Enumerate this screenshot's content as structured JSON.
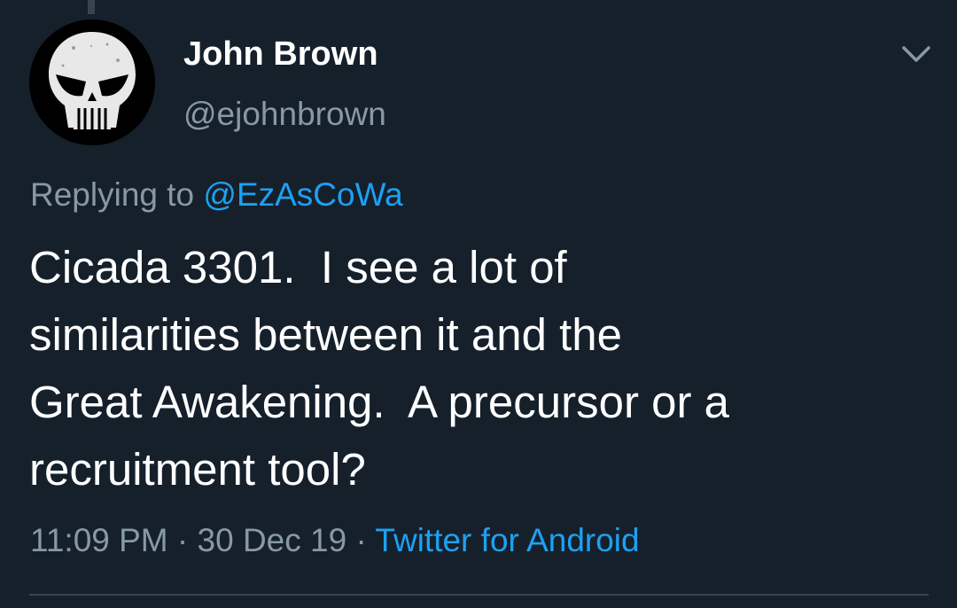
{
  "colors": {
    "background": "#15202b",
    "primary_text": "#ffffff",
    "secondary_text": "#8899a6",
    "accent": "#1da1f2",
    "divider": "#38444d"
  },
  "tweet": {
    "author": {
      "display_name": "John Brown",
      "handle": "@ejohnbrown",
      "avatar_icon": "punisher-skull-icon"
    },
    "reply": {
      "prefix": "Replying to",
      "mention": "@EzAsCoWa"
    },
    "text_lines": [
      "Cicada 3301.  I see a lot of",
      "similarities between it and the",
      "Great Awakening.  A precursor or a",
      "recruitment tool?"
    ],
    "meta": {
      "time": "11:09 PM",
      "separator": "·",
      "date": "30 Dec 19",
      "source": "Twitter for Android"
    },
    "menu_icon": "chevron-down-icon"
  }
}
